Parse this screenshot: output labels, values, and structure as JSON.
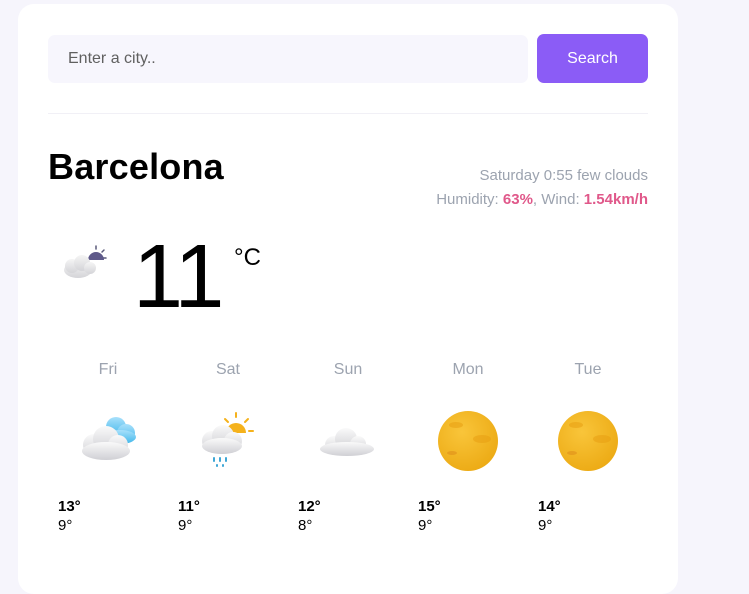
{
  "search": {
    "placeholder": "Enter a city..",
    "button_label": "Search"
  },
  "current": {
    "city": "Barcelona",
    "day": "Saturday",
    "time": "0:55",
    "description": "few clouds",
    "humidity_label": "Humidity:",
    "humidity_value": "63%",
    "wind_label": "Wind:",
    "wind_value": "1.54km/h",
    "temperature": "11",
    "unit": "°C",
    "icon": "few-clouds-night-icon"
  },
  "forecast": [
    {
      "day": "Fri",
      "max": "13°",
      "min": "9°",
      "icon": "cloudy-icon"
    },
    {
      "day": "Sat",
      "max": "11°",
      "min": "9°",
      "icon": "rain-sun-icon"
    },
    {
      "day": "Sun",
      "max": "12°",
      "min": "8°",
      "icon": "cloud-icon"
    },
    {
      "day": "Mon",
      "max": "15°",
      "min": "9°",
      "icon": "sun-icon"
    },
    {
      "day": "Tue",
      "max": "14°",
      "min": "9°",
      "icon": "sun-icon"
    }
  ],
  "colors": {
    "accent": "#8b5cf6",
    "highlight": "#e0588a",
    "muted": "#9ca3af",
    "background": "#f6f5fc"
  }
}
